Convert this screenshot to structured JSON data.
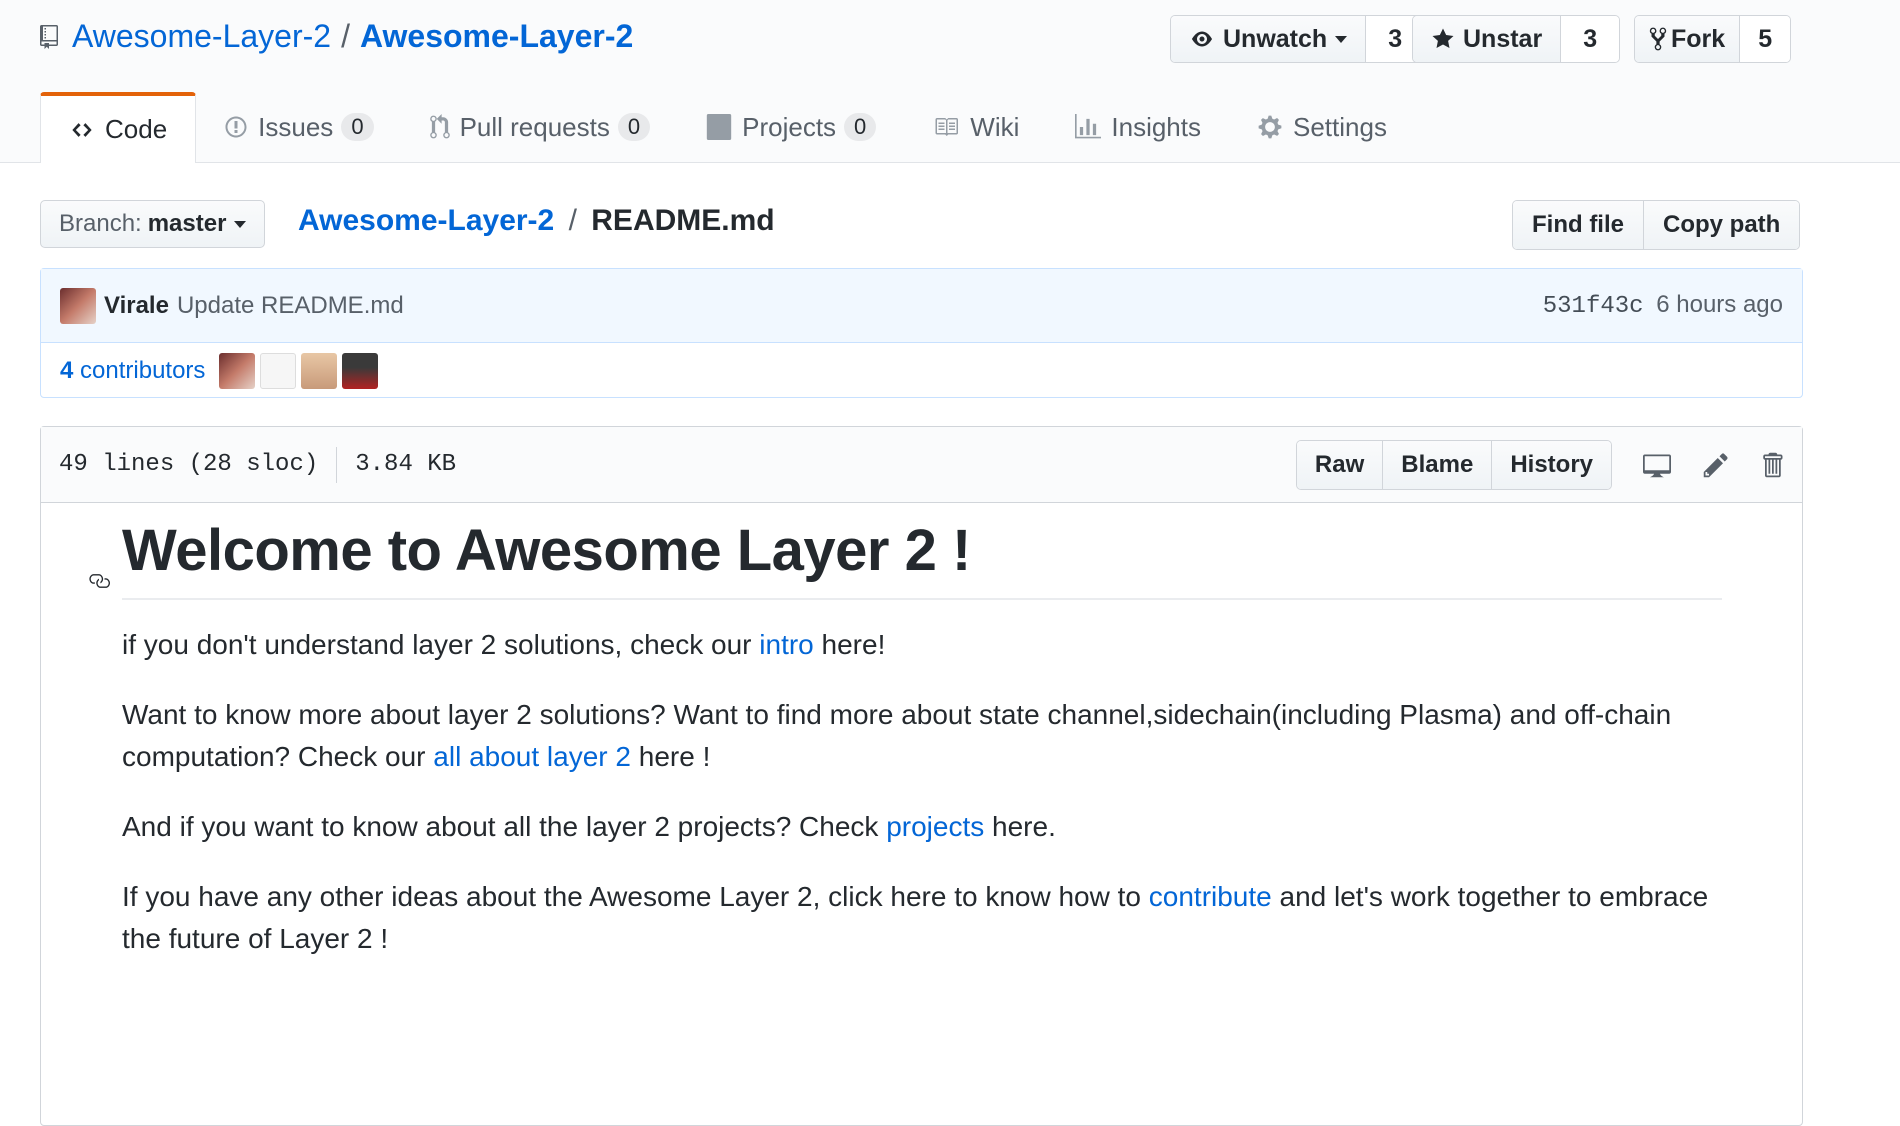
{
  "repo": {
    "owner": "Awesome-Layer-2",
    "separator": "/",
    "name": "Awesome-Layer-2"
  },
  "actions": {
    "watch_label": "Unwatch",
    "watch_count": "3",
    "star_label": "Unstar",
    "star_count": "3",
    "fork_label": "Fork",
    "fork_count": "5"
  },
  "tabs": [
    {
      "label": "Code",
      "icon": "code-icon"
    },
    {
      "label": "Issues",
      "counter": "0",
      "icon": "issue-opened-icon"
    },
    {
      "label": "Pull requests",
      "counter": "0",
      "icon": "git-pull-request-icon"
    },
    {
      "label": "Projects",
      "counter": "0",
      "icon": "project-icon"
    },
    {
      "label": "Wiki",
      "icon": "book-icon"
    },
    {
      "label": "Insights",
      "icon": "graph-icon"
    },
    {
      "label": "Settings",
      "icon": "gear-icon"
    }
  ],
  "file_nav": {
    "branch_prefix": "Branch:",
    "branch": "master",
    "breadcrumb_repo": "Awesome-Layer-2",
    "breadcrumb_sep": "/",
    "file_name": "README.md",
    "find_file": "Find file",
    "copy_path": "Copy path"
  },
  "commit": {
    "author": "Virale",
    "message": "Update README.md",
    "sha": "531f43c",
    "time": "6 hours ago",
    "contributors_count": "4",
    "contributors_label": "contributors"
  },
  "file": {
    "lines": "49 lines (28 sloc)",
    "size": "3.84 KB",
    "raw": "Raw",
    "blame": "Blame",
    "history": "History"
  },
  "readme": {
    "heading": "Welcome to Awesome Layer 2 !",
    "p1_before": "if you don't understand layer 2 solutions, check our ",
    "p1_link": "intro",
    "p1_after": " here!",
    "p2_before": "Want to know more about layer 2 solutions? Want to find more about state channel,sidechain(including Plasma) and off-chain computation? Check our ",
    "p2_link": "all about layer 2",
    "p2_after": " here !",
    "p3_before": "And if you want to know about all the layer 2 projects? Check ",
    "p3_link": "projects",
    "p3_after": " here.",
    "p4_before": "If you have any other ideas about the Awesome Layer 2, click here to know how to ",
    "p4_link": "contribute",
    "p4_after": " and let's work together to embrace the future of Layer 2 !"
  },
  "colors": {
    "link": "#0366d6",
    "tab_accent": "#e36209",
    "commit_bg": "#f1f8ff"
  }
}
